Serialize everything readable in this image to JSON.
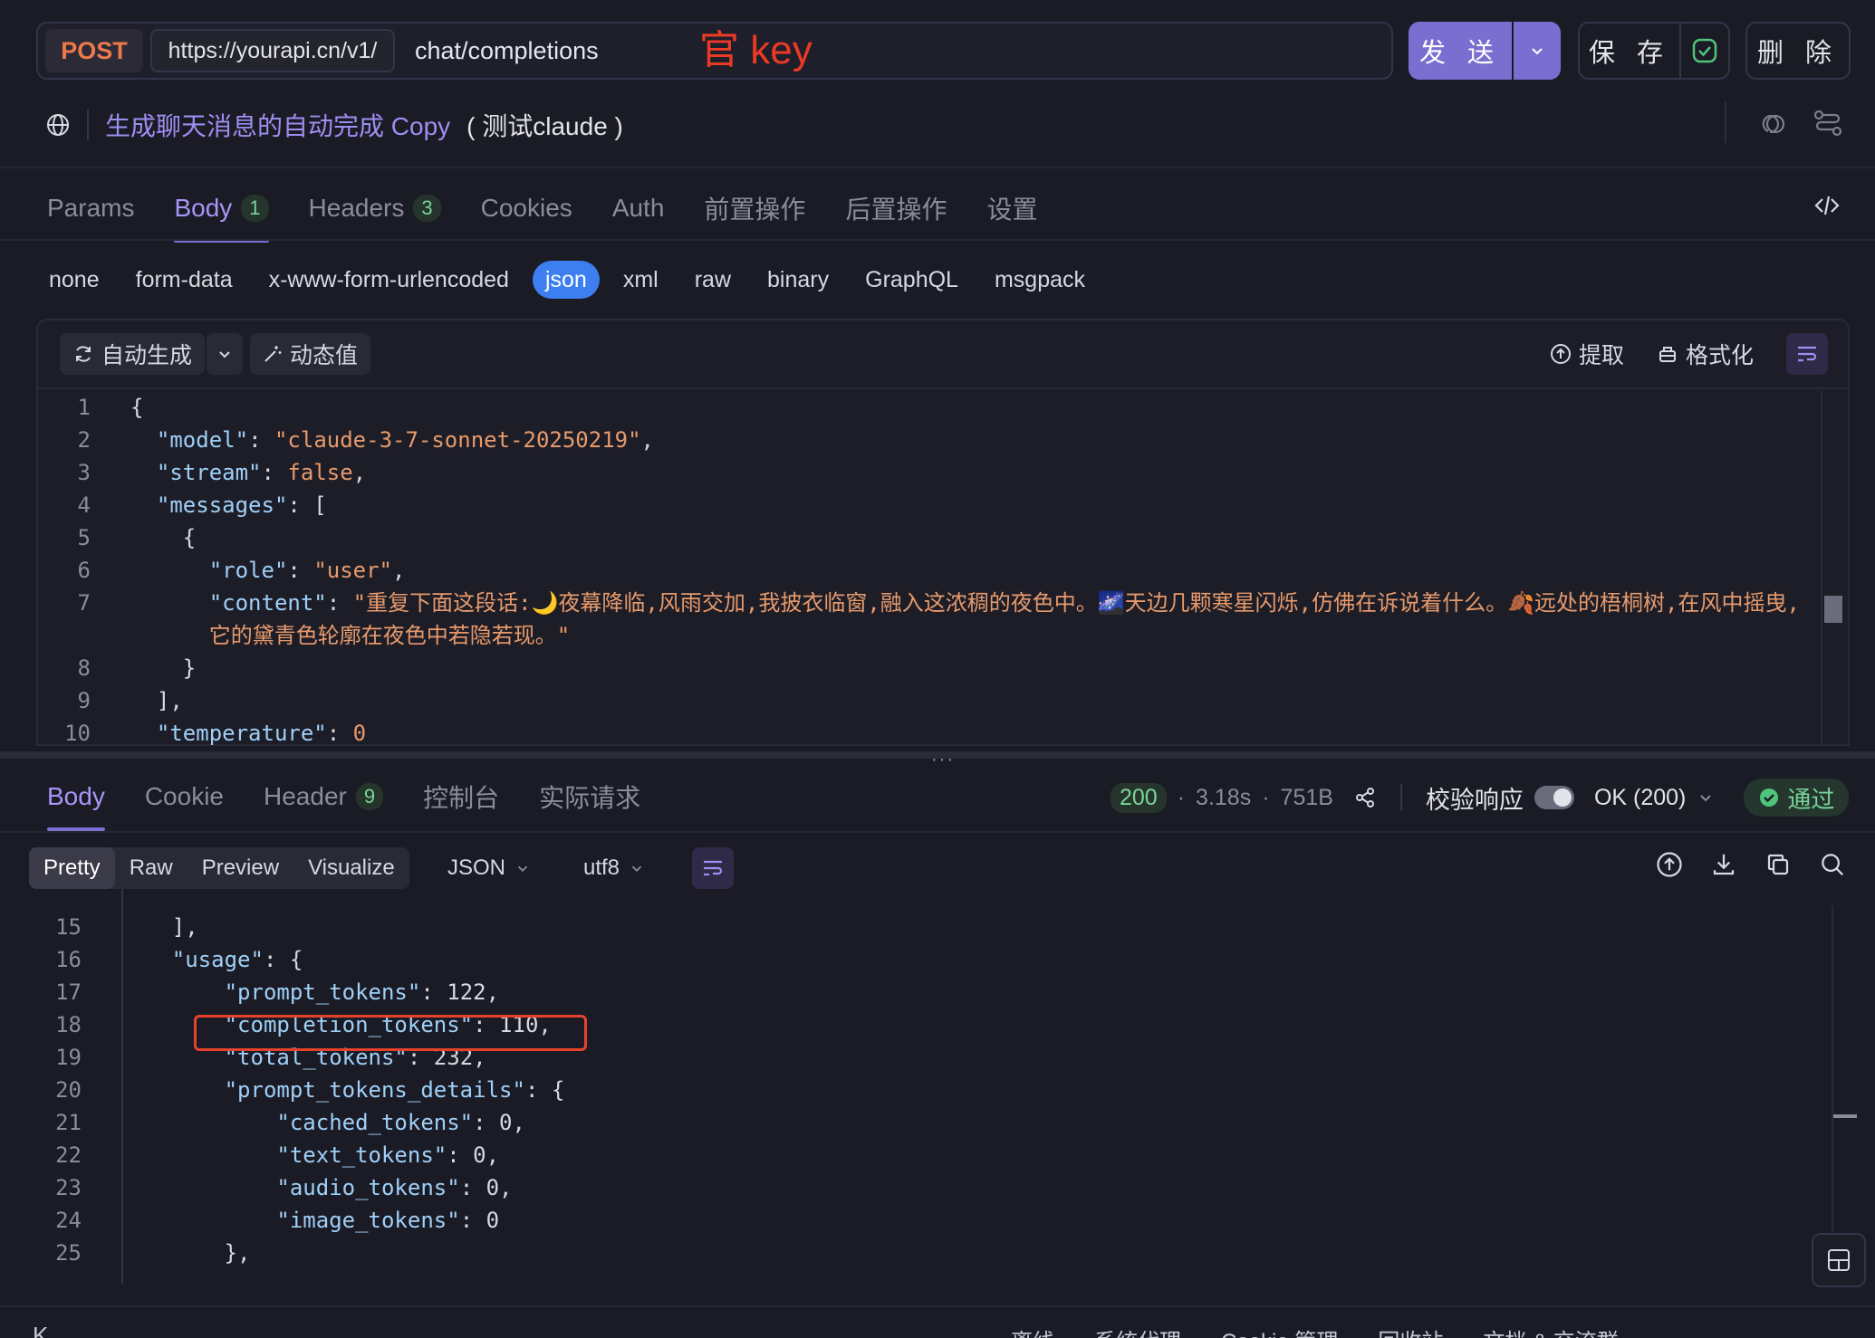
{
  "request": {
    "method": "POST",
    "base_url": "https://yourapi.cn/v1/",
    "path": "chat/completions",
    "annotation": "官 key",
    "send_label": "发 送",
    "save_label": "保 存",
    "delete_label": "删 除"
  },
  "title": {
    "name": "生成聊天消息的自动完成 Copy",
    "suffix": "( 测试claude )"
  },
  "tabs": [
    {
      "label": "Params",
      "badge": ""
    },
    {
      "label": "Body",
      "badge": "1",
      "active": true
    },
    {
      "label": "Headers",
      "badge": "3"
    },
    {
      "label": "Cookies",
      "badge": ""
    },
    {
      "label": "Auth",
      "badge": ""
    },
    {
      "label": "前置操作",
      "badge": ""
    },
    {
      "label": "后置操作",
      "badge": ""
    },
    {
      "label": "设置",
      "badge": ""
    }
  ],
  "body_types": [
    "none",
    "form-data",
    "x-www-form-urlencoded",
    "json",
    "xml",
    "raw",
    "binary",
    "GraphQL",
    "msgpack"
  ],
  "body_type_active": "json",
  "editor_toolbar": {
    "auto_generate": "自动生成",
    "dynamic_value": "动态值",
    "extract": "提取",
    "format": "格式化"
  },
  "request_body_lines": [
    {
      "n": "1",
      "parts": [
        [
          "p",
          "{"
        ]
      ]
    },
    {
      "n": "2",
      "parts": [
        [
          "p",
          "  "
        ],
        [
          "k",
          "\"model\""
        ],
        [
          "p",
          ": "
        ],
        [
          "s",
          "\"claude-3-7-sonnet-20250219\""
        ],
        [
          "p",
          ","
        ]
      ]
    },
    {
      "n": "3",
      "parts": [
        [
          "p",
          "  "
        ],
        [
          "k",
          "\"stream\""
        ],
        [
          "p",
          ": "
        ],
        [
          "s",
          "false"
        ],
        [
          "p",
          ","
        ]
      ]
    },
    {
      "n": "4",
      "parts": [
        [
          "p",
          "  "
        ],
        [
          "k",
          "\"messages\""
        ],
        [
          "p",
          ": ["
        ]
      ]
    },
    {
      "n": "5",
      "parts": [
        [
          "p",
          "    {"
        ]
      ]
    },
    {
      "n": "6",
      "parts": [
        [
          "p",
          "      "
        ],
        [
          "k",
          "\"role\""
        ],
        [
          "p",
          ": "
        ],
        [
          "s",
          "\"user\""
        ],
        [
          "p",
          ","
        ]
      ]
    },
    {
      "n": "7",
      "parts": [
        [
          "p",
          "      "
        ],
        [
          "k",
          "\"content\""
        ],
        [
          "p",
          ": "
        ],
        [
          "s",
          "\"重复下面这段话:🌙夜幕降临,风雨交加,我披衣临窗,融入这浓稠的夜色中。🌌天边几颗寒星闪烁,仿佛在诉说着什么。🍂远处的梧桐树,在风中摇曳,"
        ]
      ]
    },
    {
      "n": "",
      "parts": [
        [
          "p",
          "      "
        ],
        [
          "s",
          "它的黛青色轮廓在夜色中若隐若现。\""
        ]
      ]
    },
    {
      "n": "8",
      "parts": [
        [
          "p",
          "    }"
        ]
      ]
    },
    {
      "n": "9",
      "parts": [
        [
          "p",
          "  ],"
        ]
      ]
    },
    {
      "n": "10",
      "parts": [
        [
          "p",
          "  "
        ],
        [
          "k",
          "\"temperature\""
        ],
        [
          "p",
          ": "
        ],
        [
          "s",
          "0"
        ]
      ]
    }
  ],
  "response": {
    "tabs": [
      {
        "label": "Body",
        "badge": "",
        "active": true
      },
      {
        "label": "Cookie",
        "badge": ""
      },
      {
        "label": "Header",
        "badge": "9"
      },
      {
        "label": "控制台",
        "badge": ""
      },
      {
        "label": "实际请求",
        "badge": ""
      }
    ],
    "status_code": "200",
    "time": "3.18s",
    "size": "751B",
    "validate_label": "校验响应",
    "status_text": "OK (200)",
    "pass_label": "通过",
    "view_tabs": [
      "Pretty",
      "Raw",
      "Preview",
      "Visualize"
    ],
    "view_active": "Pretty",
    "format": "JSON",
    "encoding": "utf8",
    "lines": [
      {
        "n": "15",
        "parts": [
          [
            "p",
            "    ],"
          ]
        ]
      },
      {
        "n": "16",
        "parts": [
          [
            "p",
            "    "
          ],
          [
            "k",
            "\"usage\""
          ],
          [
            "p",
            ": {"
          ]
        ]
      },
      {
        "n": "17",
        "parts": [
          [
            "p",
            "        "
          ],
          [
            "k",
            "\"prompt_tokens\""
          ],
          [
            "p",
            ": 122,"
          ]
        ]
      },
      {
        "n": "18",
        "parts": [
          [
            "p",
            "        "
          ],
          [
            "k",
            "\"completion_tokens\""
          ],
          [
            "p",
            ": 110,"
          ]
        ]
      },
      {
        "n": "19",
        "parts": [
          [
            "p",
            "        "
          ],
          [
            "k",
            "\"total_tokens\""
          ],
          [
            "p",
            ": 232,"
          ]
        ]
      },
      {
        "n": "20",
        "parts": [
          [
            "p",
            "        "
          ],
          [
            "k",
            "\"prompt_tokens_details\""
          ],
          [
            "p",
            ": {"
          ]
        ]
      },
      {
        "n": "21",
        "parts": [
          [
            "p",
            "            "
          ],
          [
            "k",
            "\"cached_tokens\""
          ],
          [
            "p",
            ": 0,"
          ]
        ]
      },
      {
        "n": "22",
        "parts": [
          [
            "p",
            "            "
          ],
          [
            "k",
            "\"text_tokens\""
          ],
          [
            "p",
            ": 0,"
          ]
        ]
      },
      {
        "n": "23",
        "parts": [
          [
            "p",
            "            "
          ],
          [
            "k",
            "\"audio_tokens\""
          ],
          [
            "p",
            ": 0,"
          ]
        ]
      },
      {
        "n": "24",
        "parts": [
          [
            "p",
            "            "
          ],
          [
            "k",
            "\"image_tokens\""
          ],
          [
            "p",
            ": 0"
          ]
        ]
      },
      {
        "n": "25",
        "parts": [
          [
            "p",
            "        },"
          ]
        ]
      }
    ]
  },
  "footer": {
    "left": "K",
    "items": [
      "离线",
      "系统代理",
      "Cookie 管理",
      "回收站",
      "文档 & 交流群"
    ]
  },
  "colors": {
    "accent": "#7b6ed1",
    "method": "#ec7a4a",
    "annotation": "#ea3a24",
    "json_active": "#3d7ff0",
    "success": "#7ad49a"
  }
}
